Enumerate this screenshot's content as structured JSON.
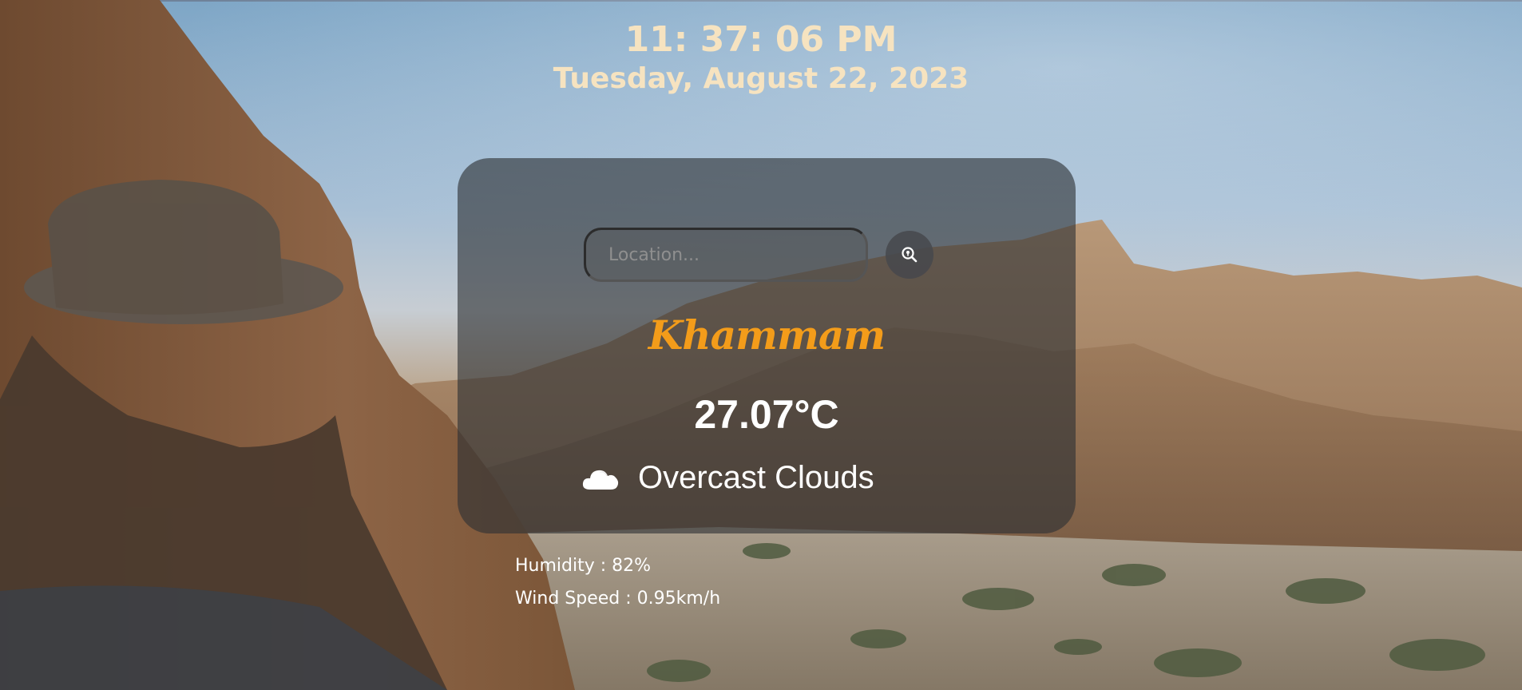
{
  "clock": {
    "time": "11: 37: 06 PM",
    "date": "Tuesday, August 22, 2023"
  },
  "search": {
    "placeholder": "Location...",
    "value": "",
    "button_icon": "search-location-icon"
  },
  "weather": {
    "city": "Khammam",
    "temperature": "27.07°C",
    "condition": "Overcast Clouds",
    "condition_icon": "cloud-icon",
    "humidity": "Humidity : 82%",
    "wind_speed": "Wind Speed : 0.95km/h"
  },
  "colors": {
    "clock_text": "#f6e3c0",
    "city_text": "#f39c1a",
    "card_background": "rgba(45,48,52,0.62)",
    "text": "#ffffff"
  }
}
